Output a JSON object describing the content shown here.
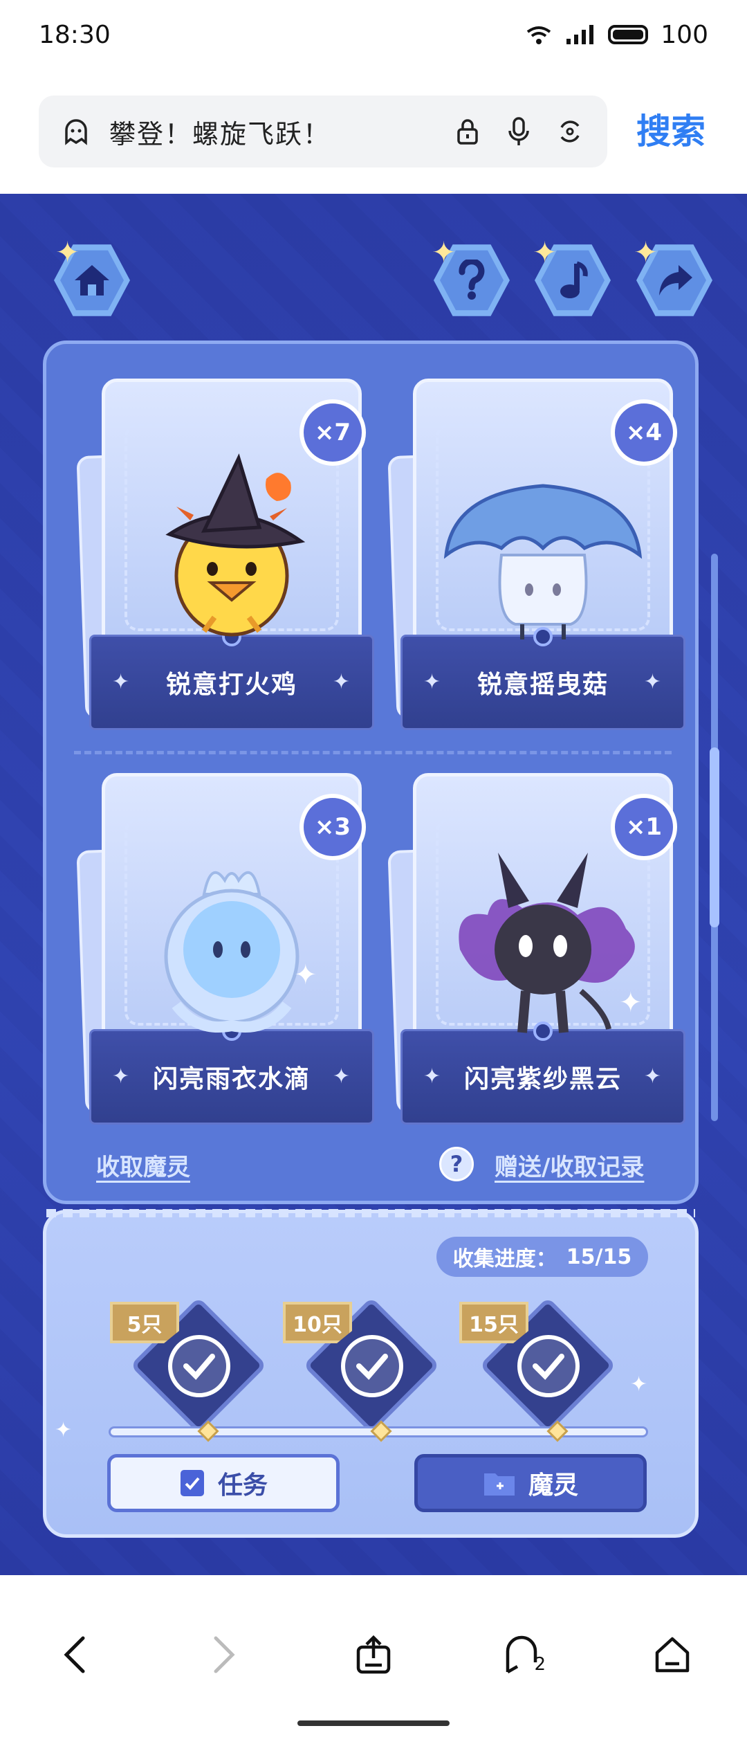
{
  "status_bar": {
    "time": "18:30",
    "battery": "100"
  },
  "search": {
    "query": "攀登！螺旋飞跃！",
    "button": "搜索"
  },
  "game": {
    "cards": [
      {
        "name": "锐意打火鸡",
        "count": "×7"
      },
      {
        "name": "锐意摇曳菇",
        "count": "×4"
      },
      {
        "name": "闪亮雨衣水滴",
        "count": "×3"
      },
      {
        "name": "闪亮紫纱黑云",
        "count": "×1"
      }
    ],
    "links": {
      "collect": "收取魔灵",
      "records": "赠送/收取记录",
      "help": "?"
    },
    "progress": {
      "label": "收集进度：",
      "value": "15/15"
    },
    "milestones": [
      {
        "tag": "5只"
      },
      {
        "tag": "10只"
      },
      {
        "tag": "15只"
      }
    ],
    "tabs": {
      "task": "任务",
      "spirits": "魔灵"
    }
  },
  "nav": {
    "tabs_count": "2"
  }
}
